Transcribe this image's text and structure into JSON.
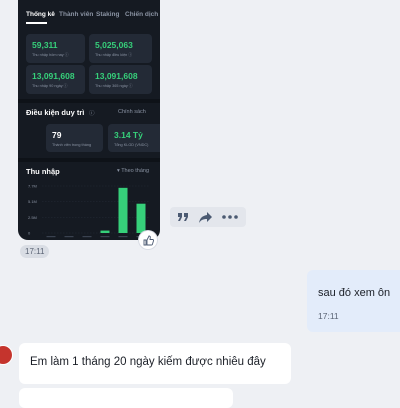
{
  "screenshot": {
    "tabs": [
      "Thống kê",
      "Thành viên",
      "Staking",
      "Chiến dịch"
    ],
    "stats": [
      {
        "value": "59,311",
        "label": "Thu nhập hôm nay ⓘ"
      },
      {
        "value": "5,025,063",
        "label": "Thu nhập điều kiện ⓘ"
      },
      {
        "value": "13,091,608",
        "label": "Thu nhập 90 ngày ⓘ"
      },
      {
        "value": "13,091,608",
        "label": "Thu nhập 365 ngày ⓘ"
      }
    ],
    "conditions": {
      "title": "Điều kiện duy trì",
      "info_icon": "ⓘ",
      "policy_link": "Chính sách",
      "items": [
        {
          "value": "79",
          "label": "Thành viên trong tháng"
        },
        {
          "value": "3.14 Tỷ",
          "label": "Tổng KLGD (VNDC)"
        }
      ]
    },
    "income": {
      "title": "Thu nhập",
      "filter": "▾ Theo tháng"
    }
  },
  "chart_data": {
    "type": "bar",
    "title": "Thu nhập",
    "categories": [
      "",
      "",
      "",
      "",
      "",
      ""
    ],
    "values": [
      0,
      0,
      0,
      0.4,
      7.4,
      4.8
    ],
    "ylim": [
      0,
      7.7
    ],
    "yticks": [
      "7.7M",
      "5.1M",
      "2.5M",
      "0"
    ],
    "bar_color": "#36d07a"
  },
  "actions": {
    "quote_icon": "quote-icon",
    "share_icon": "share-icon",
    "more_icon": "more-icon",
    "like_icon": "thumbs-up-icon"
  },
  "messages": {
    "screenshot_time": "17:11",
    "outgoing": {
      "text": "sau đó xem ôn",
      "time": "17:11"
    },
    "incoming": {
      "text": "Em làm 1 tháng 20 ngày kiếm được nhiêu đây"
    }
  }
}
